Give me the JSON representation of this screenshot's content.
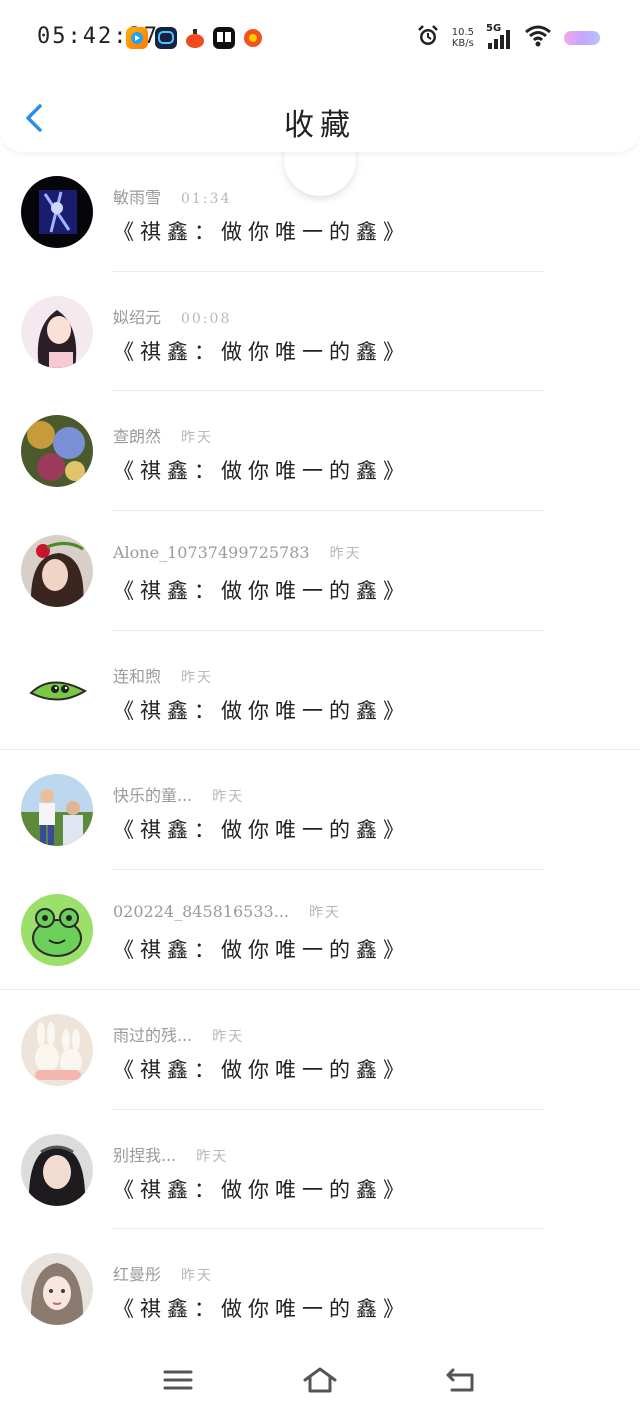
{
  "status": {
    "time": "05:42:37",
    "net_speed_value": "10.5",
    "net_speed_unit": "KB/s",
    "network": "5G",
    "app_icons": [
      "video-app-icon",
      "chat-app-icon",
      "shop-app-icon",
      "news-app-icon",
      "sale-app-icon"
    ]
  },
  "header": {
    "title": "收藏",
    "back_icon": "chevron-left-icon",
    "accent": "#2a8fe6"
  },
  "items": [
    {
      "name": "敏雨雪",
      "time": "01:34",
      "content": "《祺鑫：做你唯一的鑫》",
      "avatar": "dark-blue-anime"
    },
    {
      "name": "姒绍元",
      "time": "00:08",
      "content": "《祺鑫：做你唯一的鑫》",
      "avatar": "girl-illustration"
    },
    {
      "name": "查朗然",
      "time": "昨天",
      "content": "《祺鑫：做你唯一的鑫》",
      "avatar": "colorful-anime"
    },
    {
      "name": "Alone_10737499725783",
      "time": "昨天",
      "content": "《祺鑫：做你唯一的鑫》",
      "avatar": "girl-with-flower"
    },
    {
      "name": "连和煦",
      "time": "昨天",
      "content": "《祺鑫：做你唯一的鑫》",
      "avatar": "green-leaf-bird"
    },
    {
      "name": "快乐的童...",
      "time": "昨天",
      "content": "《祺鑫：做你唯一的鑫》",
      "avatar": "family-photo"
    },
    {
      "name": "020224_845816533...",
      "time": "昨天",
      "content": "《祺鑫：做你唯一的鑫》",
      "avatar": "green-frog"
    },
    {
      "name": "雨过的残...",
      "time": "昨天",
      "content": "《祺鑫：做你唯一的鑫》",
      "avatar": "plush-bunnies"
    },
    {
      "name": "别捏我...",
      "time": "昨天",
      "content": "《祺鑫：做你唯一的鑫》",
      "avatar": "girl-portrait"
    },
    {
      "name": "红曼彤",
      "time": "昨天",
      "content": "《祺鑫：做你唯一的鑫》",
      "avatar": "anime-girl-sketch"
    }
  ],
  "nav": {
    "menu_icon": "menu-icon",
    "home_icon": "home-icon",
    "back_icon": "return-icon"
  }
}
